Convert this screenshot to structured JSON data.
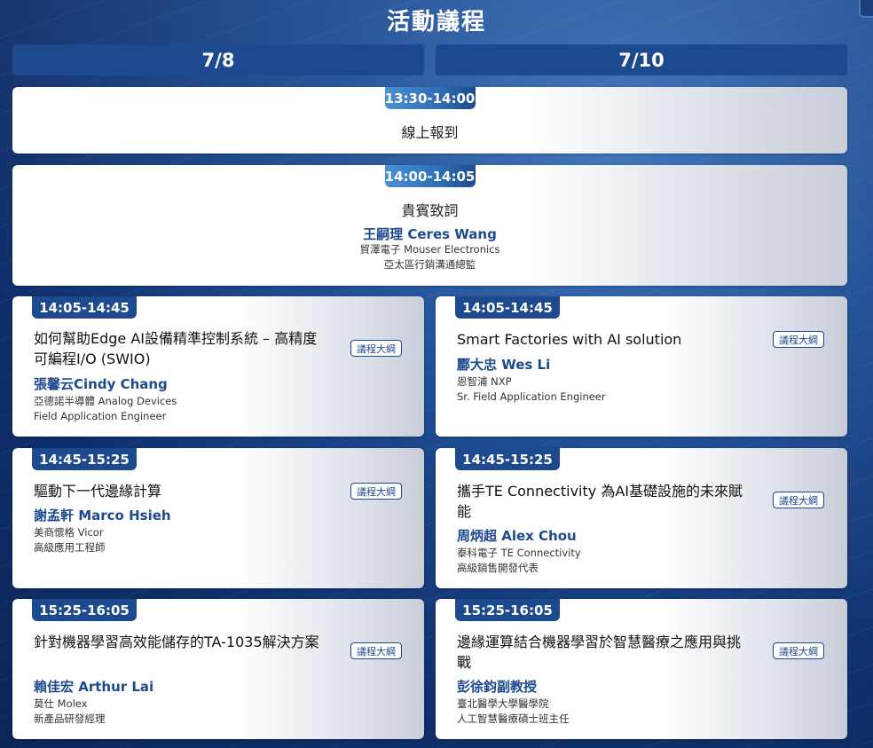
{
  "page_title": "活動議程",
  "days": [
    "7/8",
    "7/10"
  ],
  "outline_label": "議程大綱",
  "wide_sessions": [
    {
      "time": "13:30-14:00",
      "title": "線上報到"
    },
    {
      "time": "14:00-14:05",
      "title": "貴賓致詞",
      "speaker": "王嗣理 Ceres Wang",
      "company": "貿澤電子 Mouser Electronics",
      "role": "亞太區行銷溝通總監"
    }
  ],
  "day1_sessions": [
    {
      "time": "14:05-14:45",
      "title": "如何幫助Edge AI設備精準控制系統 – 高精度可編程I/O (SWIO)",
      "speaker": "張馨云Cindy Chang",
      "company": "亞德諾半導體 Analog Devices",
      "role": "Field Application Engineer"
    },
    {
      "time": "14:45-15:25",
      "title": "驅動下一代邊緣計算",
      "speaker": "謝孟軒 Marco Hsieh",
      "company": "美商懷格 Vicor",
      "role": "高級應用工程師"
    },
    {
      "time": "15:25-16:05",
      "title": "針對機器學習高效能儲存的TA-1035解決方案",
      "speaker": "賴佳宏 Arthur Lai",
      "company": "莫仕 Molex",
      "role": "新產品研發經理"
    }
  ],
  "day2_sessions": [
    {
      "time": "14:05-14:45",
      "title": "Smart Factories with AI solution",
      "speaker": "酈大忠 Wes Li",
      "company": "恩智浦 NXP",
      "role": "Sr. Field Application Engineer"
    },
    {
      "time": "14:45-15:25",
      "title": "攜手TE Connectivity 為AI基礎設施的未來賦能",
      "speaker": "周炳超 Alex Chou",
      "company": "泰科電子 TE Connectivity",
      "role": "高級銷售開發代表"
    },
    {
      "time": "15:25-16:05",
      "title": "邊緣運算結合機器學習於智慧醫療之應用與挑戰",
      "speaker": "彭徐鈞副教授",
      "company": "臺北醫學大學醫學院",
      "role": "人工智慧醫療碩士班主任"
    }
  ]
}
